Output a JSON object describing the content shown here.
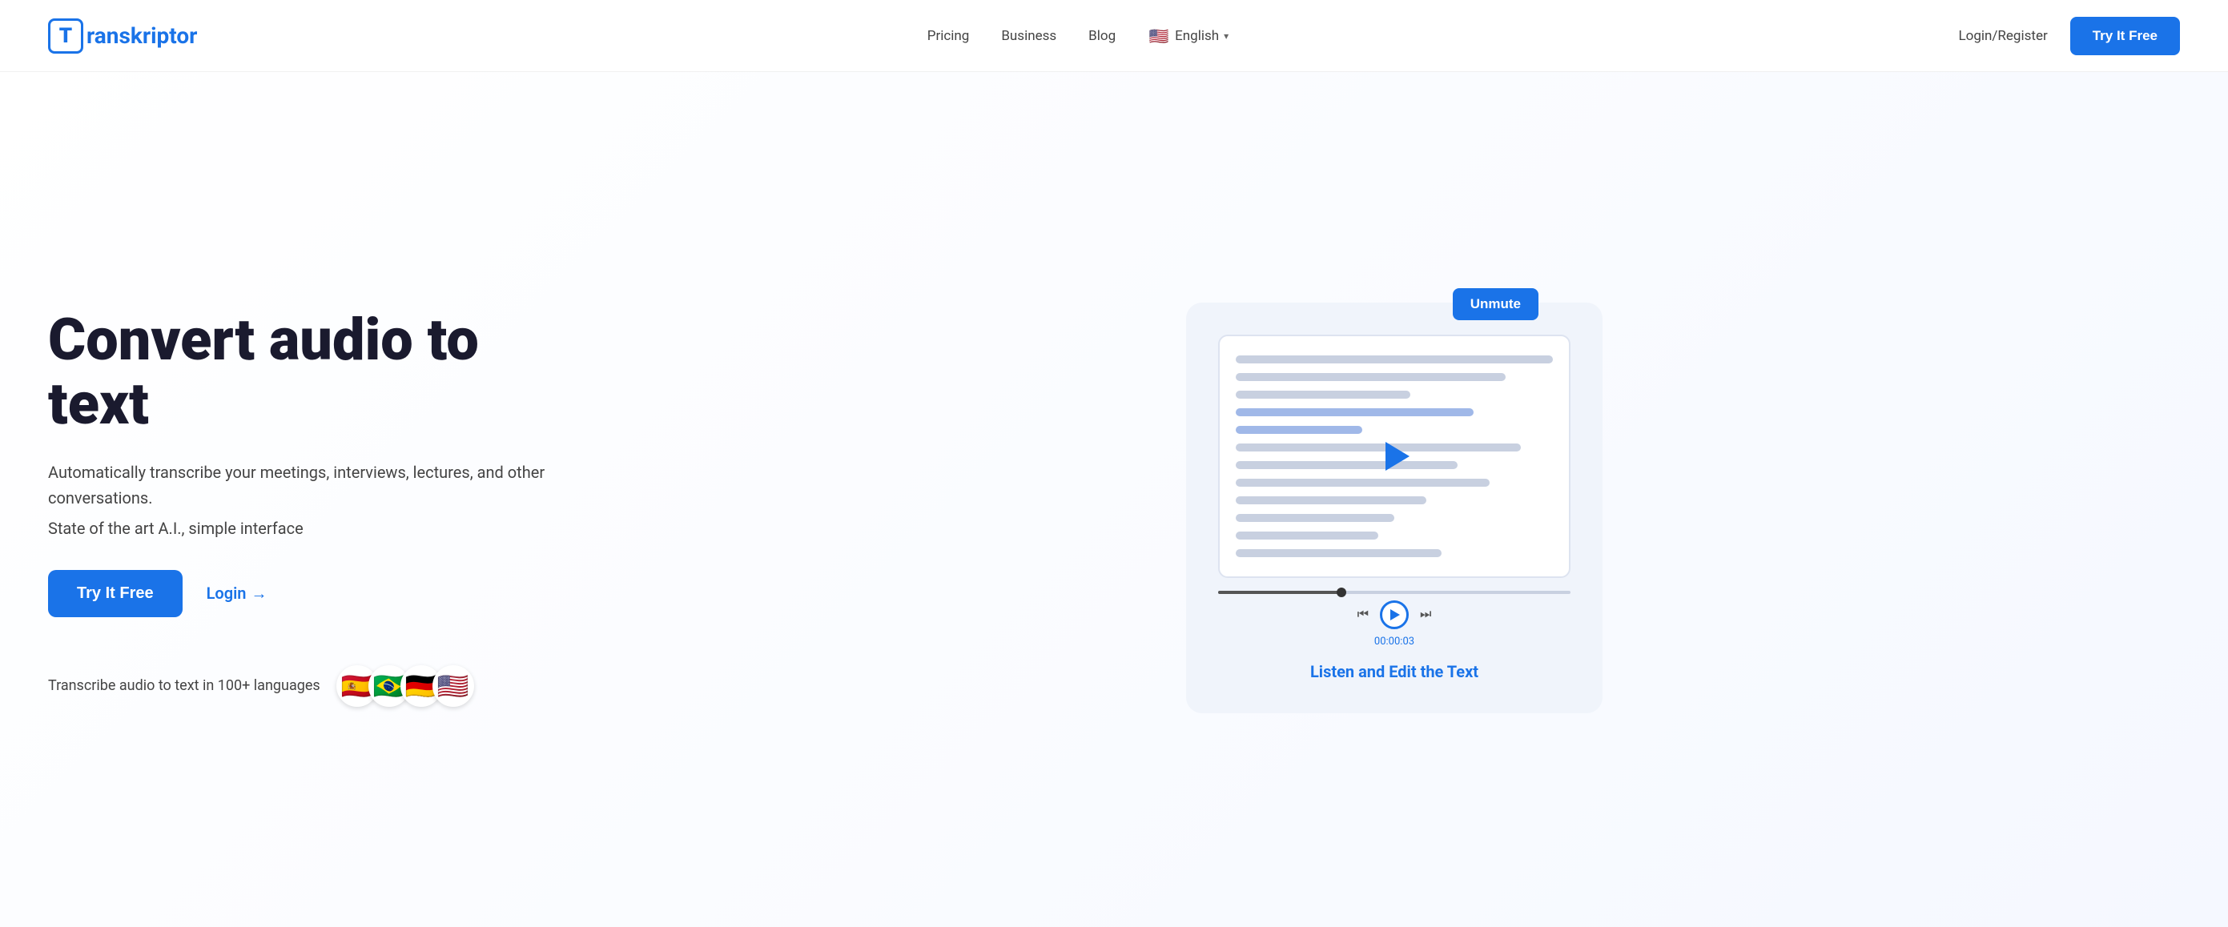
{
  "brand": {
    "logo_letter": "T",
    "logo_name": "ranskriptor",
    "full_name": "Transkriptor"
  },
  "navbar": {
    "pricing_label": "Pricing",
    "business_label": "Business",
    "blog_label": "Blog",
    "language_label": "English",
    "login_register_label": "Login/Register",
    "try_free_label": "Try It Free",
    "language_flag": "🇺🇸"
  },
  "hero": {
    "title": "Convert audio to text",
    "description1": "Automatically transcribe your meetings, interviews, lectures, and other conversations.",
    "description2": "State of the art A.I., simple interface",
    "try_free_label": "Try It Free",
    "login_label": "Login",
    "login_arrow": "→",
    "languages_text": "Transcribe audio to text in 100+ languages",
    "flags": [
      "🇪🇸",
      "🇧🇷",
      "🇩🇪",
      "🇺🇸"
    ]
  },
  "demo": {
    "unmute_label": "Unmute",
    "listen_edit_label": "Listen and Edit the Text",
    "timestamp": "00:00:03"
  }
}
